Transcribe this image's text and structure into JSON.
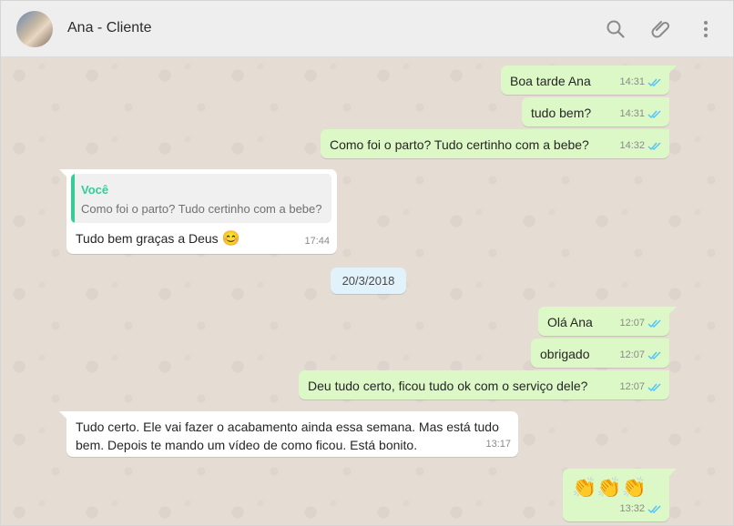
{
  "header": {
    "contact_name": "Ana - Cliente",
    "icons": [
      "search-icon",
      "attach-icon",
      "menu-icon"
    ]
  },
  "colors": {
    "outgoing_bubble": "#dcf8c6",
    "incoming_bubble": "#ffffff",
    "read_ticks": "#4fc3f7",
    "quote_accent": "#35cd96",
    "date_chip": "#e1f2fb"
  },
  "messages": [
    {
      "text": "Boa tarde Ana",
      "time": "14:31",
      "direction": "out",
      "status": "read"
    },
    {
      "text": "tudo bem?",
      "time": "14:31",
      "direction": "out",
      "status": "read"
    },
    {
      "text": "Como foi o parto? Tudo certinho com a bebe?",
      "time": "14:32",
      "direction": "out",
      "status": "read"
    },
    {
      "quote_author": "Você",
      "quote_text": "Como foi o parto? Tudo certinho com a bebe?",
      "text": "Tudo bem graças a Deus",
      "emoji": "😊",
      "time": "17:44",
      "direction": "in"
    },
    {
      "text": "Olá Ana",
      "time": "12:07",
      "direction": "out",
      "status": "read"
    },
    {
      "text": "obrigado",
      "time": "12:07",
      "direction": "out",
      "status": "read"
    },
    {
      "text": "Deu tudo certo, ficou tudo ok com o serviço dele?",
      "time": "12:07",
      "direction": "out",
      "status": "read"
    },
    {
      "text_line1": "Tudo certo. Ele vai fazer o acabamento ainda essa semana. Mas está tudo",
      "text_line2": "bem. Depois te mando um vídeo de como ficou. Está bonito.",
      "time": "13:17",
      "direction": "in"
    },
    {
      "emoji": "👏👏👏",
      "time": "13:32",
      "direction": "out",
      "status": "read"
    }
  ],
  "date_divider": "20/3/2018"
}
